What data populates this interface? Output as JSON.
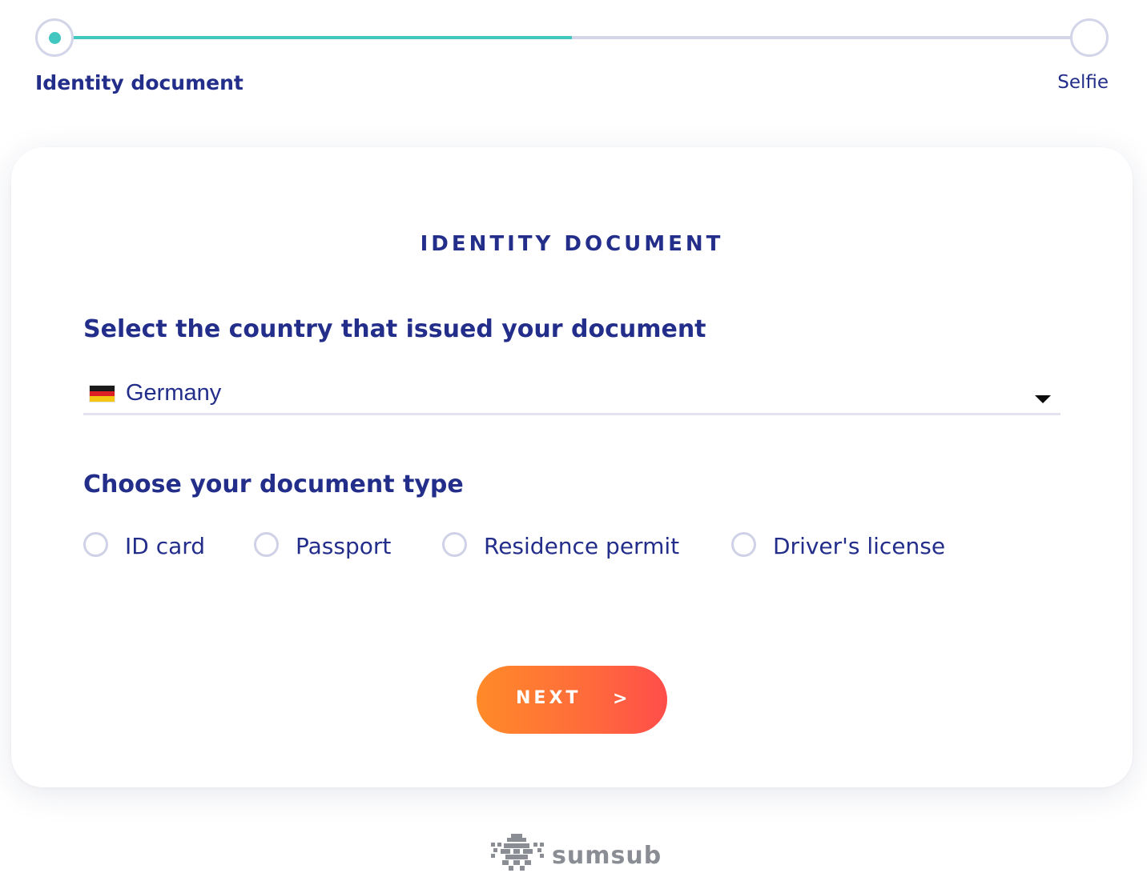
{
  "stepper": {
    "steps": [
      {
        "label": "Identity document",
        "state": "active"
      },
      {
        "label": "Selfie",
        "state": "upcoming"
      }
    ],
    "progress_percent": 50,
    "colors": {
      "progress": "#41c7c0",
      "track": "#d3d5e8"
    }
  },
  "card": {
    "title": "IDENTITY DOCUMENT",
    "country_section": {
      "heading": "Select the country that issued your document",
      "selected_country": "Germany",
      "flag_icon": "germany-flag-icon",
      "dropdown_icon": "caret-down-icon"
    },
    "doctype_section": {
      "heading": "Choose your document type",
      "options": [
        {
          "label": "ID card",
          "selected": false
        },
        {
          "label": "Passport",
          "selected": false
        },
        {
          "label": "Residence permit",
          "selected": false
        },
        {
          "label": "Driver's license",
          "selected": false
        }
      ]
    },
    "next_button": {
      "label": "NEXT",
      "arrow": ">"
    }
  },
  "footer": {
    "logo_text": "sumsub",
    "logo_icon": "sumsub-logo-icon"
  },
  "colors": {
    "primary_text": "#232e8a",
    "button_gradient_start": "#ff8a28",
    "button_gradient_end": "#ff4d4a",
    "logo_gray": "#8a8d93"
  }
}
